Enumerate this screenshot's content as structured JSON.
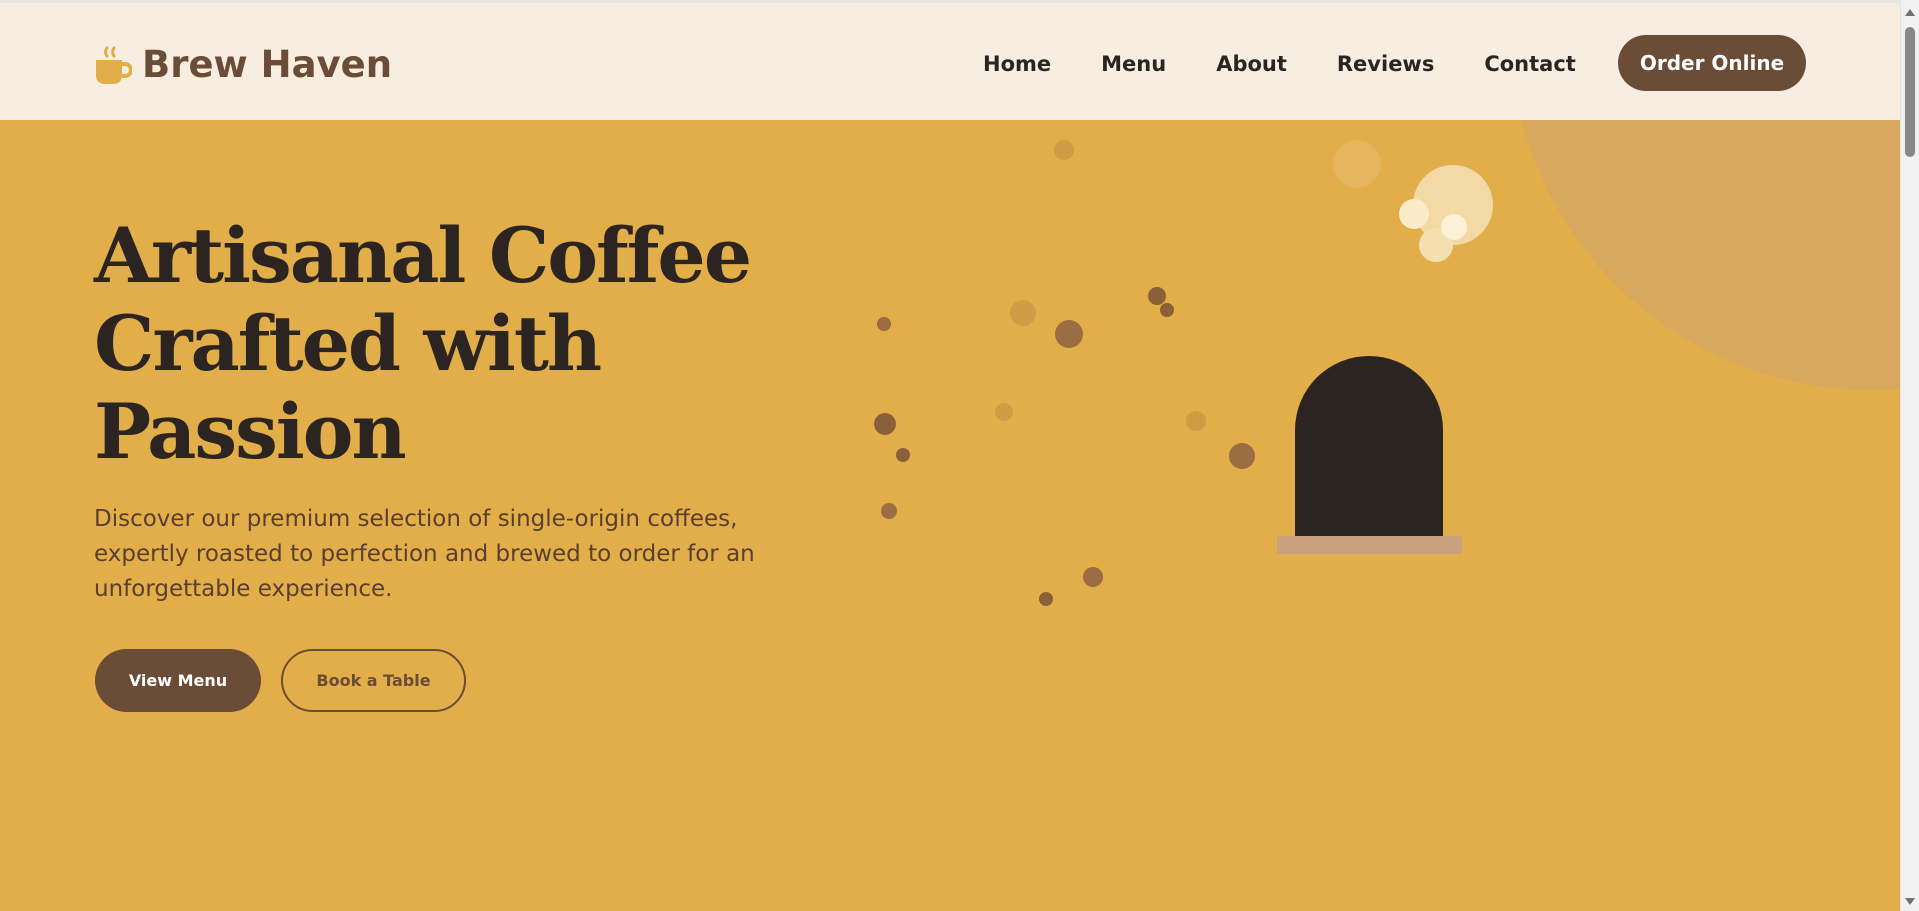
{
  "header": {
    "brand_name": "Brew Haven",
    "brand_icon": "coffee-cup-icon",
    "nav": [
      "Home",
      "Menu",
      "About",
      "Reviews",
      "Contact"
    ],
    "order_label": "Order Online"
  },
  "hero": {
    "title_lines": [
      "Artisanal Coffee",
      "Crafted with",
      "Passion"
    ],
    "description": "Discover our premium selection of single-origin coffees, expertly roasted to perfection and brewed to order for an unforgettable experience.",
    "primary_button": "View Menu",
    "secondary_button": "Book a Table"
  },
  "colors": {
    "header_bg": "#f7ede0",
    "hero_bg": "#e2ae4a",
    "brand_brown": "#6b4c37",
    "text_dark": "#2c2421"
  }
}
